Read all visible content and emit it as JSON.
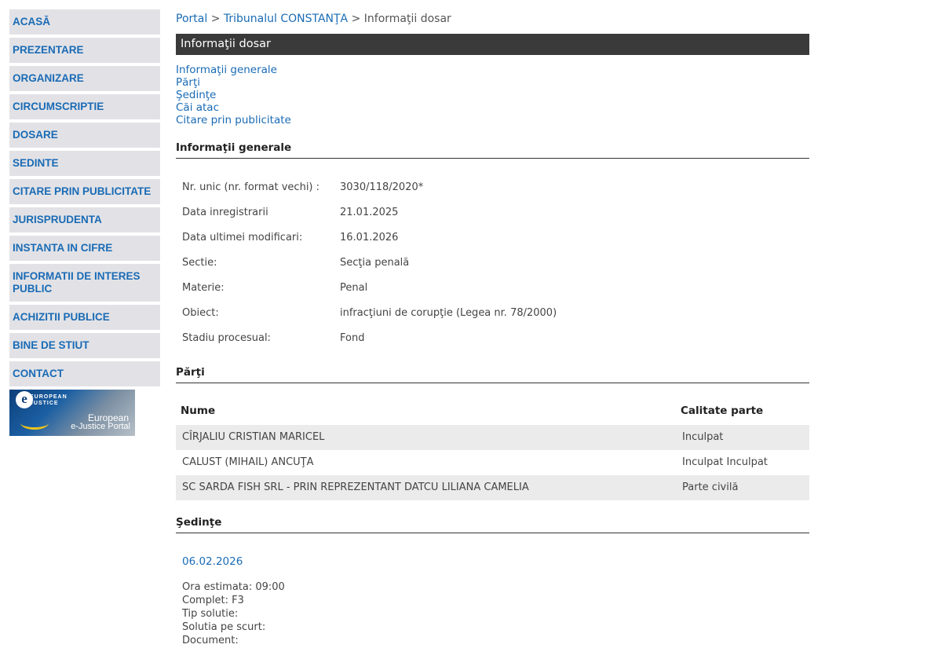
{
  "sidebar": {
    "items": [
      {
        "label": "ACASĂ"
      },
      {
        "label": "PREZENTARE"
      },
      {
        "label": "ORGANIZARE"
      },
      {
        "label": "CIRCUMSCRIPTIE"
      },
      {
        "label": "DOSARE"
      },
      {
        "label": "SEDINTE"
      },
      {
        "label": "CITARE PRIN PUBLICITATE"
      },
      {
        "label": "JURISPRUDENTA"
      },
      {
        "label": "INSTANTA IN CIFRE"
      },
      {
        "label": "INFORMATII DE INTERES PUBLIC"
      },
      {
        "label": "ACHIZITII PUBLICE"
      },
      {
        "label": "BINE DE STIUT"
      },
      {
        "label": "CONTACT"
      }
    ],
    "logo": {
      "top_text": "EUROPEAN\nJUSTICE",
      "line1": "European",
      "line2": "e-Justice Portal"
    }
  },
  "breadcrumb": {
    "portal": "Portal",
    "court": "Tribunalul CONSTANŢA",
    "current": "Informaţii dosar",
    "separator": ">"
  },
  "header": {
    "title": "Informaţii dosar"
  },
  "anchors": [
    "Informaţii generale",
    "Părţi",
    "Şedinţe",
    "Căi atac",
    "Citare prin publicitate"
  ],
  "general": {
    "title": "Informaţii generale",
    "rows": [
      {
        "label": "Nr. unic (nr. format vechi) :",
        "value": "3030/118/2020*"
      },
      {
        "label": "Data inregistrarii",
        "value": "21.01.2025"
      },
      {
        "label": "Data ultimei modificari:",
        "value": "16.01.2026"
      },
      {
        "label": "Sectie:",
        "value": "Secţia penală"
      },
      {
        "label": "Materie:",
        "value": "Penal"
      },
      {
        "label": "Obiect:",
        "value": "infracţiuni de corupţie (Legea nr. 78/2000)"
      },
      {
        "label": "Stadiu procesual:",
        "value": "Fond"
      }
    ]
  },
  "parti": {
    "title": "Părţi",
    "headers": {
      "name": "Nume",
      "role": "Calitate parte"
    },
    "rows": [
      {
        "name": "CÎRJALIU CRISTIAN MARICEL",
        "role": "Inculpat"
      },
      {
        "name": "CALUST (MIHAIL) ANCUŢA",
        "role": "Inculpat Inculpat"
      },
      {
        "name": "SC SARDA FISH SRL - PRIN REPREZENTANT DATCU LILIANA CAMELIA",
        "role": "Parte civilă"
      }
    ]
  },
  "sedinte": {
    "title": "Şedinţe",
    "date": "06.02.2026",
    "details": [
      "Ora estimata: 09:00",
      "Complet: F3",
      "Tip solutie:",
      "Solutia pe scurt:",
      "Document:"
    ]
  },
  "colors": {
    "link": "#1a6bb5",
    "nav_bg": "#e2e2e6",
    "header_bg": "#3a3a3a",
    "row_alt": "#ebebeb"
  }
}
